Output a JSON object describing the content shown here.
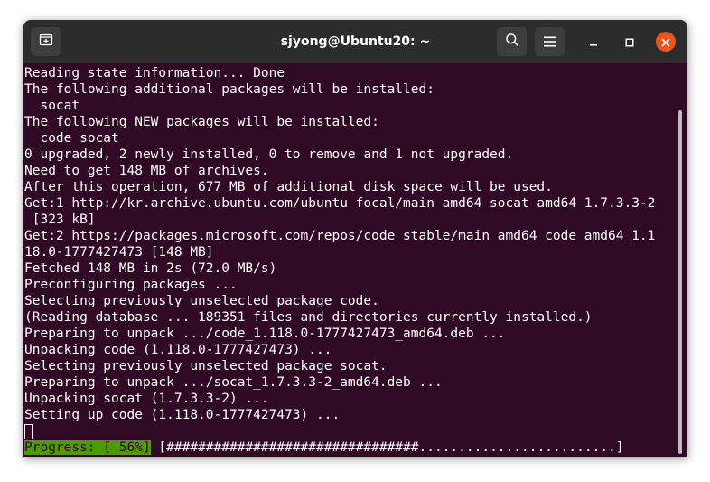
{
  "window": {
    "title": "sjyong@Ubuntu20: ~",
    "icons": {
      "new_tab": "new-tab-icon",
      "search": "search-icon",
      "menu": "hamburger-menu-icon",
      "minimize": "minimize-icon",
      "maximize": "maximize-icon",
      "close": "close-icon"
    },
    "colors": {
      "titlebar": "#2c2c2c",
      "terminal_background": "#300a24",
      "close_button": "#e95420",
      "progress_highlight": "#4e9a06"
    }
  },
  "terminal": {
    "lines": [
      "Reading state information... Done",
      "The following additional packages will be installed:",
      "  socat",
      "The following NEW packages will be installed:",
      "  code socat",
      "0 upgraded, 2 newly installed, 0 to remove and 1 not upgraded.",
      "Need to get 148 MB of archives.",
      "After this operation, 677 MB of additional disk space will be used.",
      "Get:1 http://kr.archive.ubuntu.com/ubuntu focal/main amd64 socat amd64 1.7.3.3-2",
      " [323 kB]",
      "Get:2 https://packages.microsoft.com/repos/code stable/main amd64 code amd64 1.1",
      "18.0-1777427473 [148 MB]",
      "Fetched 148 MB in 2s (72.0 MB/s)",
      "Preconfiguring packages ...",
      "Selecting previously unselected package code.",
      "(Reading database ... 189351 files and directories currently installed.)",
      "Preparing to unpack .../code_1.118.0-1777427473_amd64.deb ...",
      "Unpacking code (1.118.0-1777427473) ...",
      "Selecting previously unselected package socat.",
      "Preparing to unpack .../socat_1.7.3.3-2_amd64.deb ...",
      "Unpacking socat (1.7.3.3-2) ...",
      "Setting up code (1.118.0-1777427473) ..."
    ],
    "progress": {
      "label": "Progress: [ 56%]",
      "percent": 56,
      "bar": " [################################.........................]"
    }
  }
}
